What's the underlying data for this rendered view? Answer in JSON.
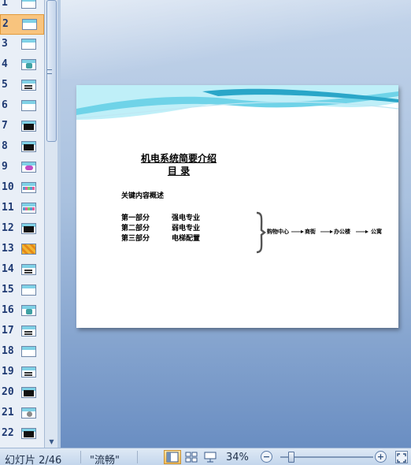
{
  "thumbnails": {
    "selected_index": 2,
    "items": [
      {
        "number": "1",
        "preview": "title"
      },
      {
        "number": "2",
        "preview": "toc"
      },
      {
        "number": "3",
        "preview": "blank"
      },
      {
        "number": "4",
        "preview": "picture"
      },
      {
        "number": "5",
        "preview": "text"
      },
      {
        "number": "6",
        "preview": "blank"
      },
      {
        "number": "7",
        "preview": "dark"
      },
      {
        "number": "8",
        "preview": "dark"
      },
      {
        "number": "9",
        "preview": "pink"
      },
      {
        "number": "10",
        "preview": "strip"
      },
      {
        "number": "11",
        "preview": "strip"
      },
      {
        "number": "12",
        "preview": "dark"
      },
      {
        "number": "13",
        "preview": "gold"
      },
      {
        "number": "14",
        "preview": "text"
      },
      {
        "number": "15",
        "preview": "blank"
      },
      {
        "number": "16",
        "preview": "picture"
      },
      {
        "number": "17",
        "preview": "text"
      },
      {
        "number": "18",
        "preview": "blank"
      },
      {
        "number": "19",
        "preview": "text"
      },
      {
        "number": "20",
        "preview": "dark"
      },
      {
        "number": "21",
        "preview": "flower"
      },
      {
        "number": "22",
        "preview": "dark"
      }
    ]
  },
  "slide": {
    "title_line1": "机电系统简要介绍",
    "title_line2": "目  录",
    "heading": "关键内容概述",
    "parts": [
      {
        "label": "第一部分",
        "desc": "强电专业"
      },
      {
        "label": "第二部分",
        "desc": "弱电专业"
      },
      {
        "label": "第三部分",
        "desc": "电梯配置"
      }
    ],
    "flow": [
      "购物中心",
      "商街",
      "办公楼",
      "公寓"
    ],
    "theme_colors": {
      "wave_light": "#bfeff8",
      "wave_mid": "#6fd3e8",
      "wave_dark": "#2aa6c8"
    }
  },
  "statusbar": {
    "slide_indicator": "幻灯片 2/46",
    "theme_name": "\"流畅\"",
    "zoom_label": "34%",
    "zoom_minus": "−",
    "zoom_plus": "+",
    "zoom_fraction": 0.12,
    "views": [
      "normal-view",
      "slide-sorter-view",
      "slideshow-view"
    ]
  },
  "icons": {
    "scroll_down": "▼",
    "grip": "≡"
  }
}
